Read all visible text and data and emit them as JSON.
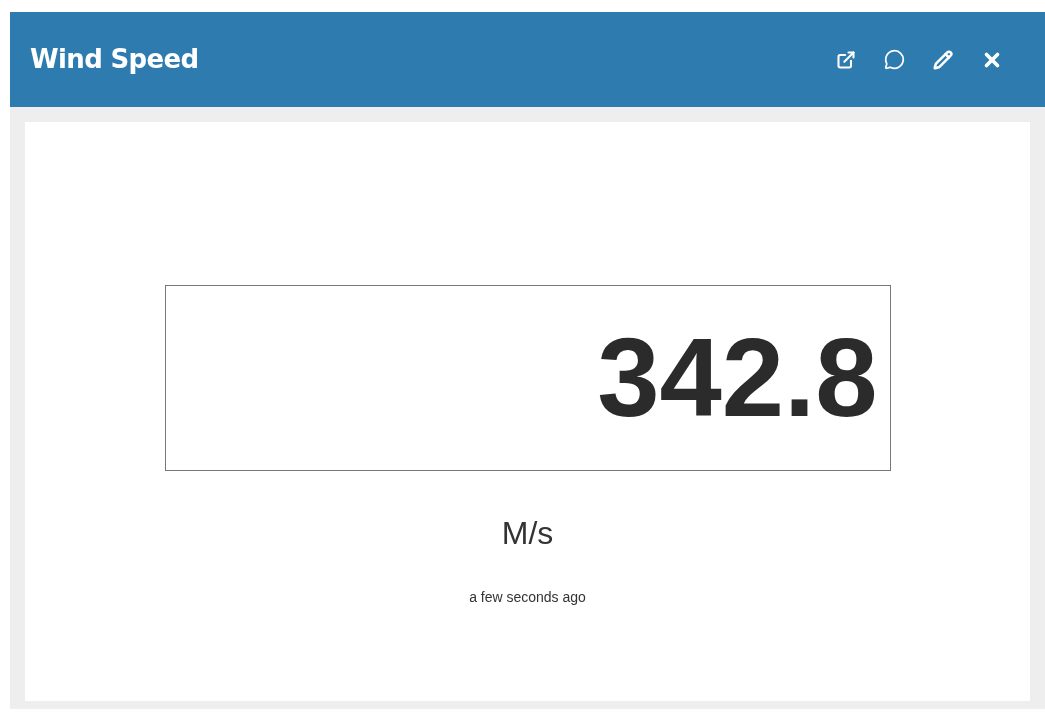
{
  "panel": {
    "title": "Wind Speed"
  },
  "reading": {
    "value": "342.8",
    "unit": "M/s",
    "updated": "a few seconds ago"
  }
}
